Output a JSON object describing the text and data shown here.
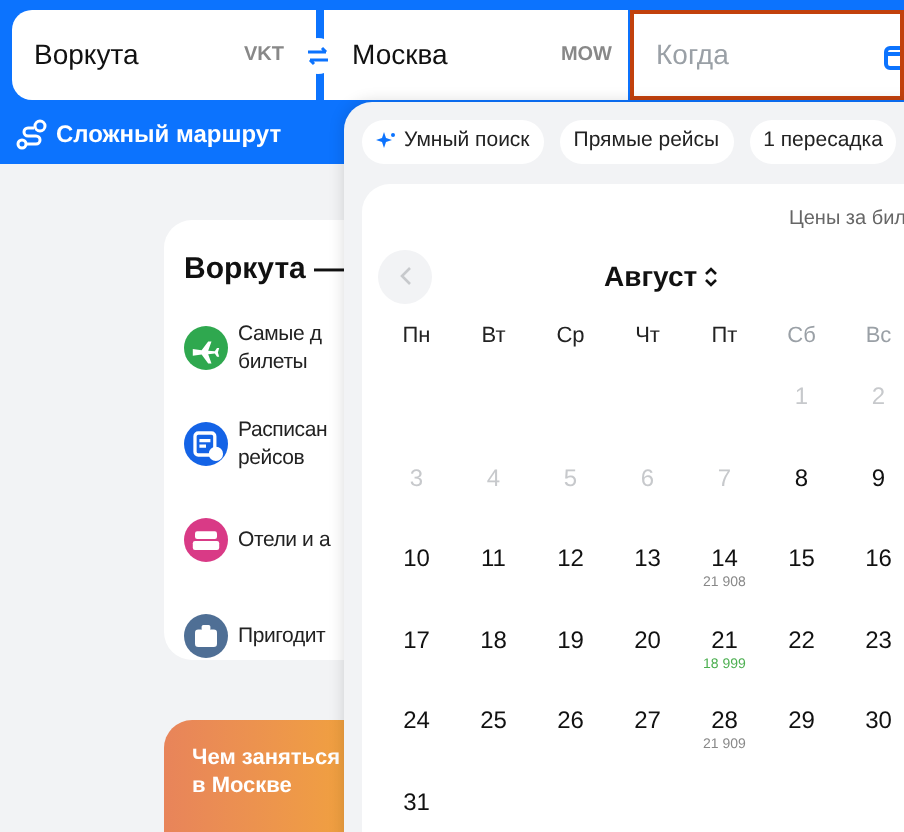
{
  "search": {
    "origin": {
      "value": "Воркута",
      "code": "VKT"
    },
    "destination": {
      "value": "Москва",
      "code": "MOW"
    },
    "date": {
      "placeholder": "Когда",
      "focused": true
    }
  },
  "complex_route": "Сложный маршрут",
  "info_card": {
    "title": "Воркута —",
    "items": [
      {
        "kind": "tickets",
        "text": "Самые д",
        "text2": "билеты"
      },
      {
        "kind": "schedule",
        "text": "Расписан",
        "text2": "рейсов"
      },
      {
        "kind": "hotels",
        "text": "Отели и а"
      },
      {
        "kind": "useful",
        "text": "Пригодит"
      }
    ]
  },
  "promo": {
    "line1": "Чем заняться",
    "line2": "в Москве"
  },
  "calendar": {
    "chips": [
      {
        "label": "Умный поиск",
        "icon": true
      },
      {
        "label": "Прямые рейсы",
        "icon": false
      },
      {
        "label": "1 пересадка",
        "icon": false
      }
    ],
    "prices_note": "Цены за бил",
    "month": "Август",
    "weekdays": [
      {
        "label": "Пн",
        "weekend": false
      },
      {
        "label": "Вт",
        "weekend": false
      },
      {
        "label": "Ср",
        "weekend": false
      },
      {
        "label": "Чт",
        "weekend": false
      },
      {
        "label": "Пт",
        "weekend": false
      },
      {
        "label": "Сб",
        "weekend": true
      },
      {
        "label": "Вс",
        "weekend": true
      }
    ],
    "weeks": [
      {
        "right_aligned": true,
        "days": [
          {
            "day": "1",
            "disabled": true
          },
          {
            "day": "2",
            "disabled": true
          }
        ]
      },
      {
        "days": [
          {
            "day": "3",
            "disabled": true
          },
          {
            "day": "4",
            "disabled": true
          },
          {
            "day": "5",
            "disabled": true
          },
          {
            "day": "6",
            "disabled": true
          },
          {
            "day": "7",
            "disabled": true
          },
          {
            "day": "8",
            "disabled": false
          },
          {
            "day": "9",
            "disabled": false
          }
        ]
      },
      {
        "days": [
          {
            "day": "10",
            "disabled": false
          },
          {
            "day": "11",
            "disabled": false
          },
          {
            "day": "12",
            "disabled": false
          },
          {
            "day": "13",
            "disabled": false
          },
          {
            "day": "14",
            "disabled": false,
            "price": "21 908",
            "cheapest": false
          },
          {
            "day": "15",
            "disabled": false
          },
          {
            "day": "16",
            "disabled": false
          }
        ]
      },
      {
        "days": [
          {
            "day": "17",
            "disabled": false
          },
          {
            "day": "18",
            "disabled": false
          },
          {
            "day": "19",
            "disabled": false
          },
          {
            "day": "20",
            "disabled": false
          },
          {
            "day": "21",
            "disabled": false,
            "price": "18 999",
            "cheapest": true
          },
          {
            "day": "22",
            "disabled": false
          },
          {
            "day": "23",
            "disabled": false
          }
        ]
      },
      {
        "days": [
          {
            "day": "24",
            "disabled": false
          },
          {
            "day": "25",
            "disabled": false
          },
          {
            "day": "26",
            "disabled": false
          },
          {
            "day": "27",
            "disabled": false
          },
          {
            "day": "28",
            "disabled": false,
            "price": "21 909",
            "cheapest": false
          },
          {
            "day": "29",
            "disabled": false
          },
          {
            "day": "30",
            "disabled": false
          }
        ]
      },
      {
        "right_aligned": false,
        "days": [
          {
            "day": "31",
            "disabled": false
          }
        ]
      }
    ]
  }
}
